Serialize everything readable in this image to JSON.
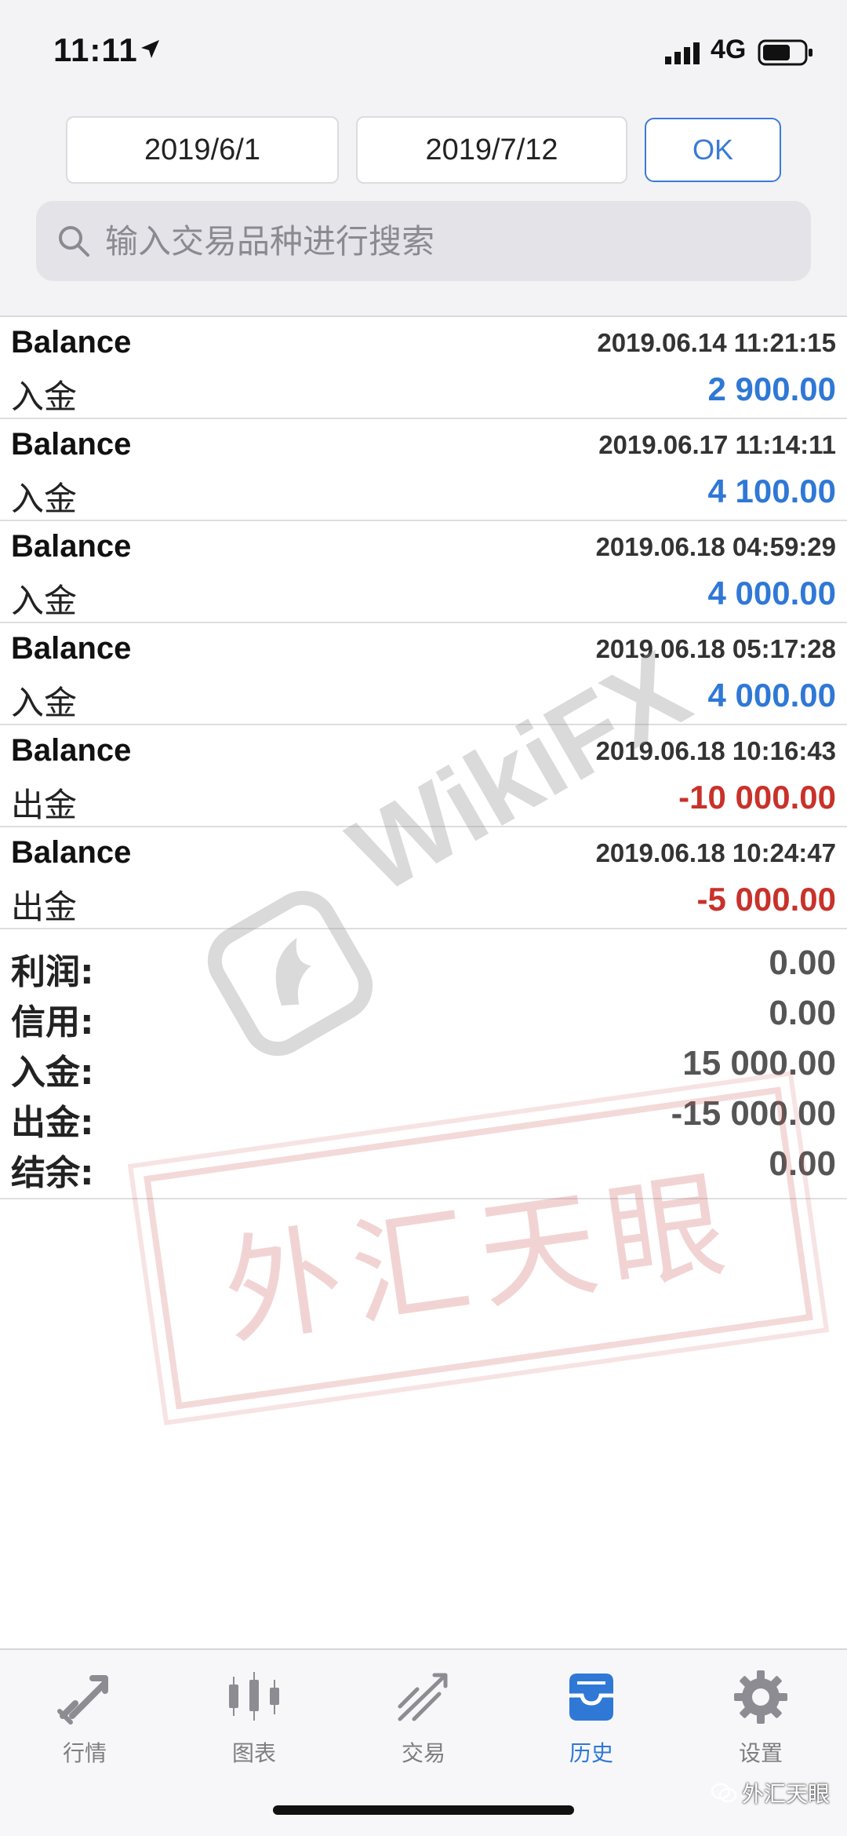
{
  "status_bar": {
    "time": "11:11",
    "network": "4G"
  },
  "filter": {
    "date_from": "2019/6/1",
    "date_to": "2019/7/12",
    "ok_label": "OK"
  },
  "search": {
    "placeholder": "输入交易品种进行搜索"
  },
  "records": [
    {
      "type": "Balance",
      "datetime": "2019.06.14 11:21:15",
      "subtype": "入金",
      "amount": "2 900.00",
      "direction": "in"
    },
    {
      "type": "Balance",
      "datetime": "2019.06.17 11:14:11",
      "subtype": "入金",
      "amount": "4 100.00",
      "direction": "in"
    },
    {
      "type": "Balance",
      "datetime": "2019.06.18 04:59:29",
      "subtype": "入金",
      "amount": "4 000.00",
      "direction": "in"
    },
    {
      "type": "Balance",
      "datetime": "2019.06.18 05:17:28",
      "subtype": "入金",
      "amount": "4 000.00",
      "direction": "in"
    },
    {
      "type": "Balance",
      "datetime": "2019.06.18 10:16:43",
      "subtype": "出金",
      "amount": "-10 000.00",
      "direction": "out"
    },
    {
      "type": "Balance",
      "datetime": "2019.06.18 10:24:47",
      "subtype": "出金",
      "amount": "-5 000.00",
      "direction": "out"
    }
  ],
  "summary": [
    {
      "label": "利润:",
      "value": "0.00"
    },
    {
      "label": "信用:",
      "value": "0.00"
    },
    {
      "label": "入金:",
      "value": "15 000.00"
    },
    {
      "label": "出金:",
      "value": "-15 000.00"
    },
    {
      "label": "结余:",
      "value": "0.00"
    }
  ],
  "colors": {
    "deposit": "#2f78d6",
    "withdrawal": "#c8322b",
    "accent": "#3a7bd5"
  },
  "watermark": {
    "text": "WikiFX",
    "stamp": "外汇天眼"
  },
  "tabs": [
    {
      "label": "行情",
      "icon": "quotes-icon",
      "active": false
    },
    {
      "label": "图表",
      "icon": "chart-icon",
      "active": false
    },
    {
      "label": "交易",
      "icon": "trade-icon",
      "active": false
    },
    {
      "label": "历史",
      "icon": "history-icon",
      "active": true
    },
    {
      "label": "设置",
      "icon": "settings-icon",
      "active": false
    }
  ],
  "credit": "外汇天眼"
}
